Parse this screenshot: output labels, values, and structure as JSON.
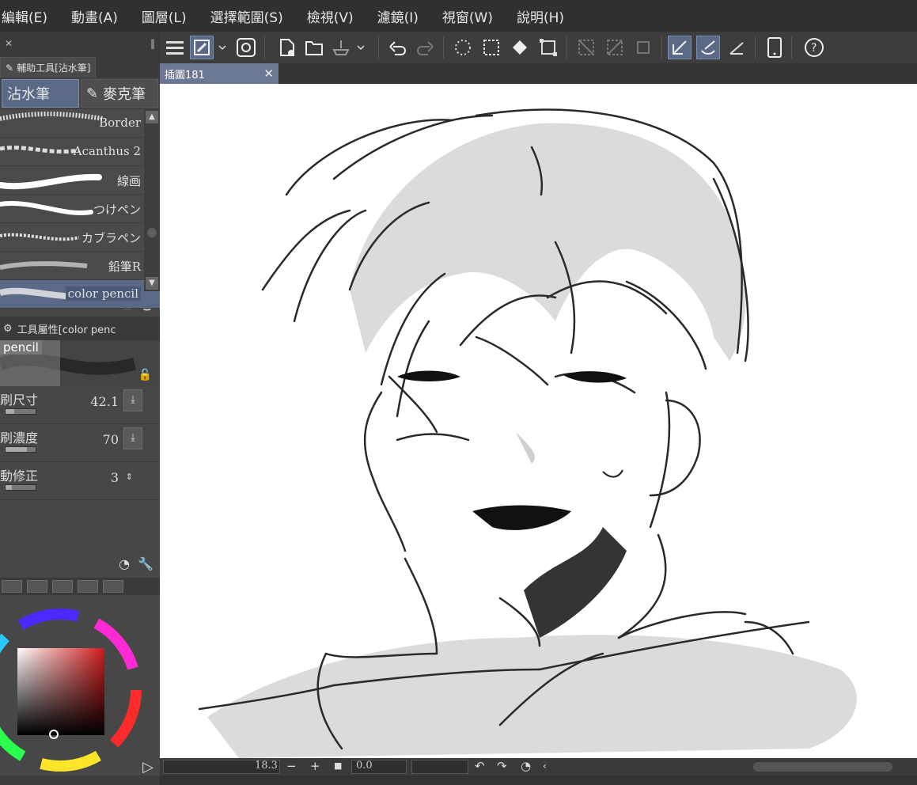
{
  "menu": [
    "編輯(E)",
    "動畫(A)",
    "圖層(L)",
    "選擇範圍(S)",
    "檢視(V)",
    "濾鏡(I)",
    "視窗(W)",
    "說明(H)"
  ],
  "subtool_panel": {
    "tab_label": "輔助工具[沾水筆]",
    "groups": [
      {
        "label": "沾水筆",
        "active": true
      },
      {
        "label": "麥克筆",
        "active": false
      }
    ],
    "brushes": [
      {
        "label": "Border",
        "selected": false
      },
      {
        "label": "Acanthus 2",
        "selected": false
      },
      {
        "label": "線画",
        "selected": false
      },
      {
        "label": "つけペン",
        "selected": false
      },
      {
        "label": "カブラペン",
        "selected": false
      },
      {
        "label": "鉛筆R",
        "selected": false
      },
      {
        "label": "color pencil",
        "selected": true
      }
    ]
  },
  "tool_property": {
    "header": "工具屬性[color penc",
    "preview_label": "pencil",
    "rows": [
      {
        "label": "刷尺寸",
        "value": "42.1",
        "level": 0.3
      },
      {
        "label": "刷濃度",
        "value": "70",
        "level": 0.7
      },
      {
        "label": "動修正",
        "value": "3",
        "level": 0.2
      }
    ]
  },
  "color": {
    "selected_hex": "#ffffff",
    "rgb_values": [
      "0",
      "0",
      "0",
      "0"
    ]
  },
  "document": {
    "tab_title": "插圖181"
  },
  "status": {
    "zoom": "18.3",
    "rotation": "0.0"
  },
  "icons": {
    "menu": "hamburger-icon",
    "undo": "undo-icon",
    "redo": "redo-icon"
  }
}
